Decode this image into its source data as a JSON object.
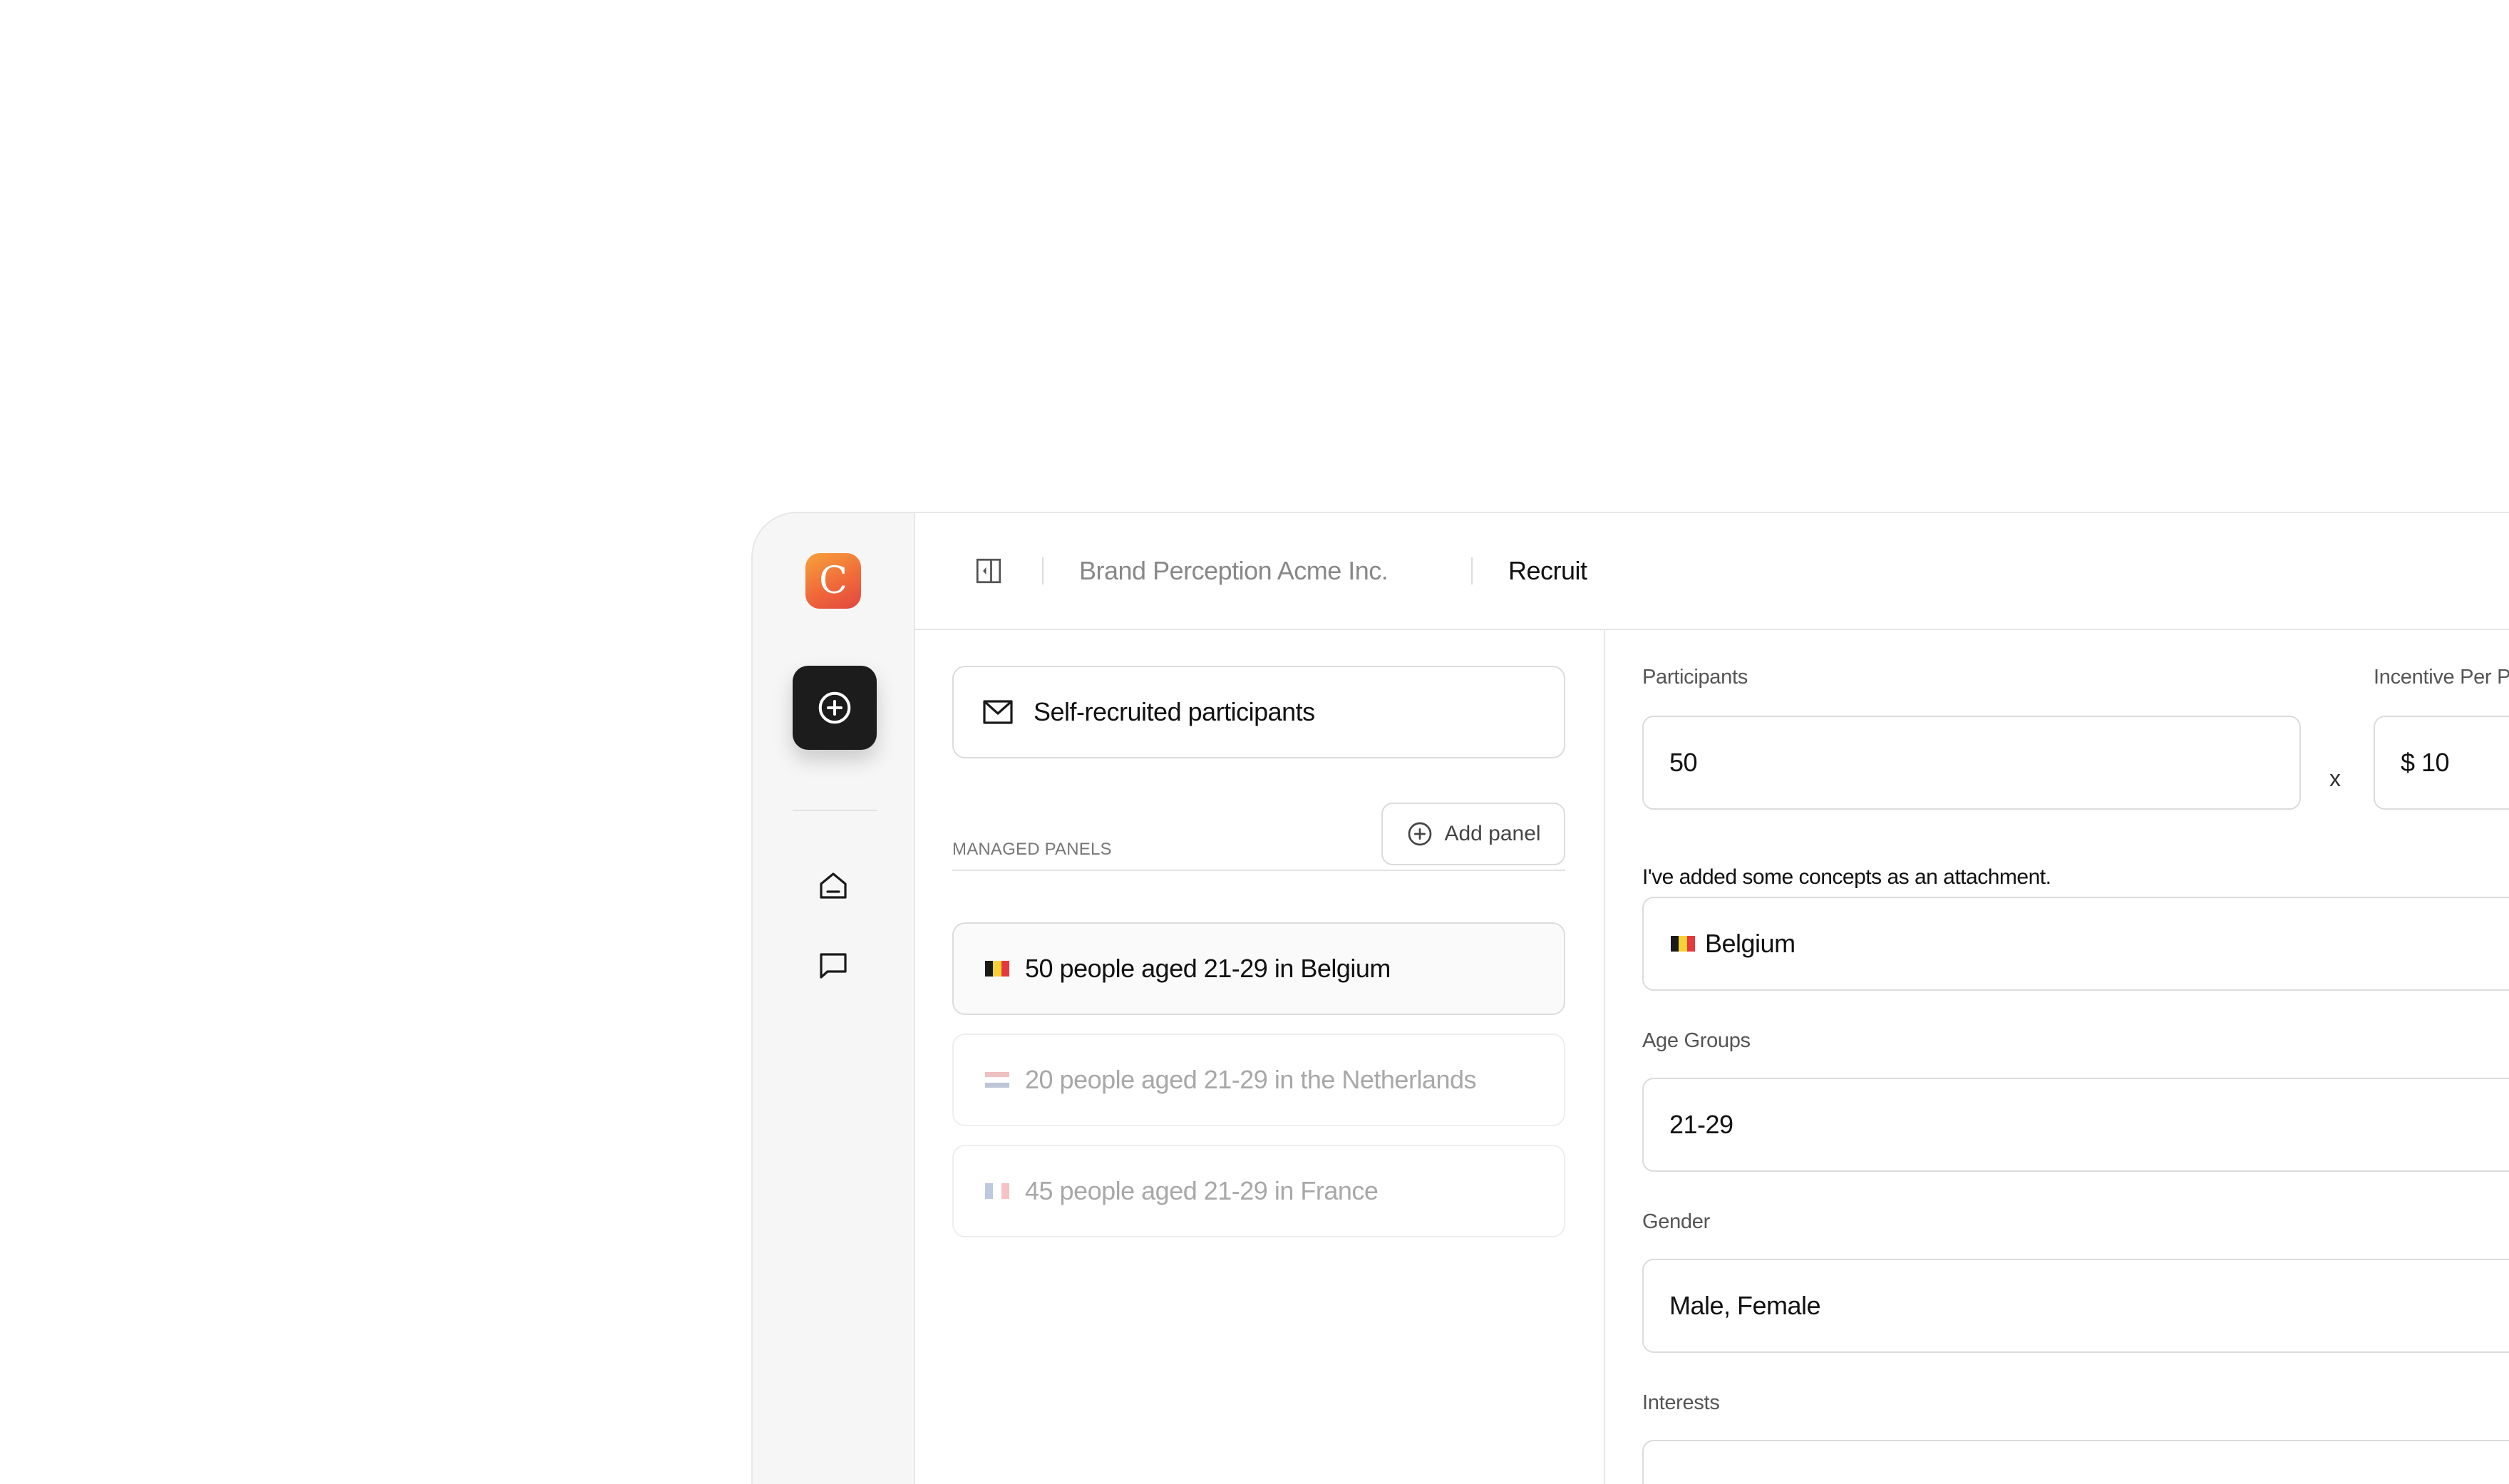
{
  "app": {
    "logo_letter": "C"
  },
  "breadcrumb": {
    "project": "Brand Perception Acme Inc.",
    "current": "Recruit"
  },
  "left": {
    "self_recruited": "Self-recruited participants",
    "managed_panels_title": "MANAGED PANELS",
    "add_panel_label": "Add panel",
    "panels": [
      {
        "label": "50 people aged 21-29 in Belgium",
        "country": "Belgium",
        "active": true
      },
      {
        "label": "20 people aged 21-29 in the Netherlands",
        "country": "Netherlands",
        "active": false
      },
      {
        "label": "45 people aged 21-29 in France",
        "country": "France",
        "active": false
      }
    ]
  },
  "form": {
    "participants_label": "Participants",
    "participants_value": "50",
    "times_symbol": "x",
    "incentive_label": "Incentive Per Pe",
    "incentive_value": "$ 10",
    "note": "I've added some concepts as an attachment.",
    "country_value": "Belgium",
    "age_groups_label": "Age Groups",
    "age_groups_value": "21-29",
    "gender_label": "Gender",
    "gender_value": "Male, Female",
    "interests_label": "Interests"
  },
  "colors": {
    "accent_dark": "#1c1c1c",
    "logo_gradient_start": "#f7a23a",
    "logo_gradient_end": "#e2463f",
    "border": "#dcdcdc",
    "sidebar_bg": "#f6f6f6"
  }
}
